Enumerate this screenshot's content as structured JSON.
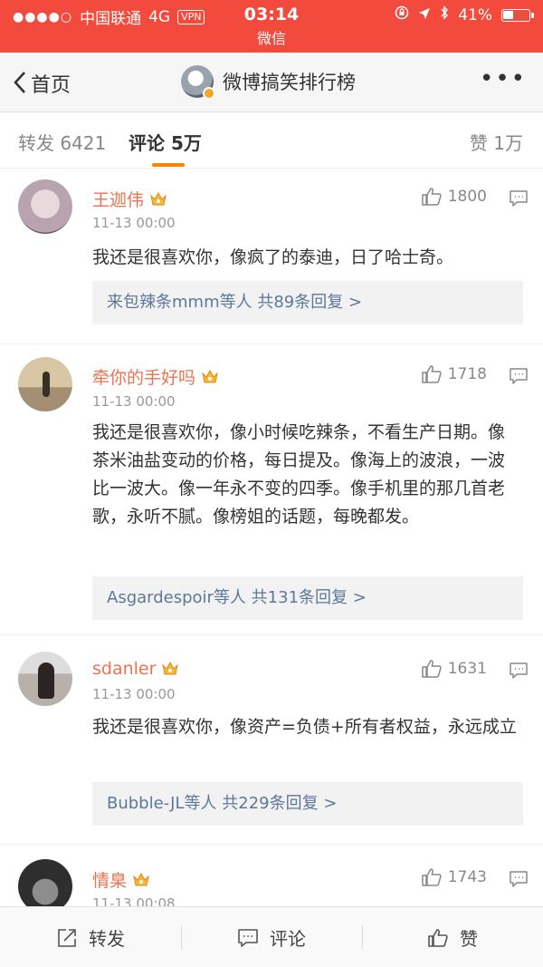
{
  "status_bar": {
    "signal": "●●●●○",
    "carrier": "中国联通",
    "network": "4G",
    "vpn": "VPN",
    "time": "03:14",
    "battery": "41%",
    "battery_level": 0.41
  },
  "app_name": "微信",
  "nav": {
    "back_label": "首页",
    "title": "微博搞笑排行榜",
    "more": "•••"
  },
  "tabs": {
    "repost": "转发 6421",
    "comment": "评论 5万",
    "like": "赞 1万"
  },
  "comments": [
    {
      "name": "王迦伟",
      "time": "11-13 00:00",
      "likes": "1800",
      "text": "我还是很喜欢你，像疯了的泰迪，日了哈士奇。",
      "replies": "来包辣条mmm等人  共89条回复 >"
    },
    {
      "name": "牵你的手好吗",
      "time": "11-13 00:00",
      "likes": "1718",
      "text": "我还是很喜欢你，像小时候吃辣条，不看生产日期。像茶米油盐变动的价格，每日提及。像海上的波浪，一波比一波大。像一年永不变的四季。像手机里的那几首老歌，永听不腻。像榜姐的话题，每晚都发。",
      "replies": "Asgardespoir等人  共131条回复 >"
    },
    {
      "name": "sdanler",
      "time": "11-13 00:00",
      "likes": "1631",
      "text": "我还是很喜欢你，像资产=负债+所有者权益，永远成立",
      "replies": "Bubble-JL等人  共229条回复 >"
    },
    {
      "name": "情臬",
      "time": "11-13 00:08",
      "likes": "1743"
    }
  ],
  "bottom_bar": {
    "repost": "转发",
    "comment": "评论",
    "like": "赞"
  },
  "colors": {
    "status_bar": "#f24a3d",
    "username": "#eb7350",
    "tab_underline": "#ff8200",
    "reply_link": "#5d7899"
  }
}
